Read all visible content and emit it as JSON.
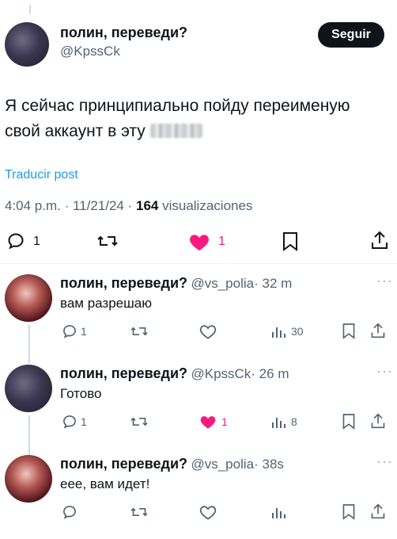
{
  "tweet": {
    "name": "полин, переведи?",
    "handle": "@KpssCk",
    "follow_label": "Seguir",
    "text_line1": "Я сейчас принципиально пойду переименую",
    "text_line2": "свой аккаунт в эту",
    "translate_label": "Traducir post",
    "meta_time": "4:04 p.m. · 11/21/24 · ",
    "meta_views_count": "164",
    "meta_views_label": " visualizaciones",
    "actions": {
      "replies": "1",
      "likes": "1"
    }
  },
  "replies": [
    {
      "name": "полин, переведи?",
      "handle": "@vs_polia",
      "time": "· 32 m",
      "text": "вам разрешаю",
      "replies": "1",
      "likes": "",
      "views": "30"
    },
    {
      "name": "полин, переведи?",
      "handle": "@KpssCk",
      "time": "· 26 m",
      "text": "Готово",
      "replies": "1",
      "likes": "1",
      "views": "8"
    },
    {
      "name": "полин, переведи?",
      "handle": "@vs_polia",
      "time": "· 38s",
      "text": "еее, вам идет!",
      "replies": "",
      "likes": "",
      "views": ""
    }
  ],
  "icons": [
    "reply-icon",
    "retweet-icon",
    "heart-icon",
    "bookmark-icon",
    "share-icon",
    "views-icon",
    "more-icon"
  ],
  "colors": {
    "like": "#f91880",
    "link": "#1d9bf0",
    "muted": "#536471"
  }
}
